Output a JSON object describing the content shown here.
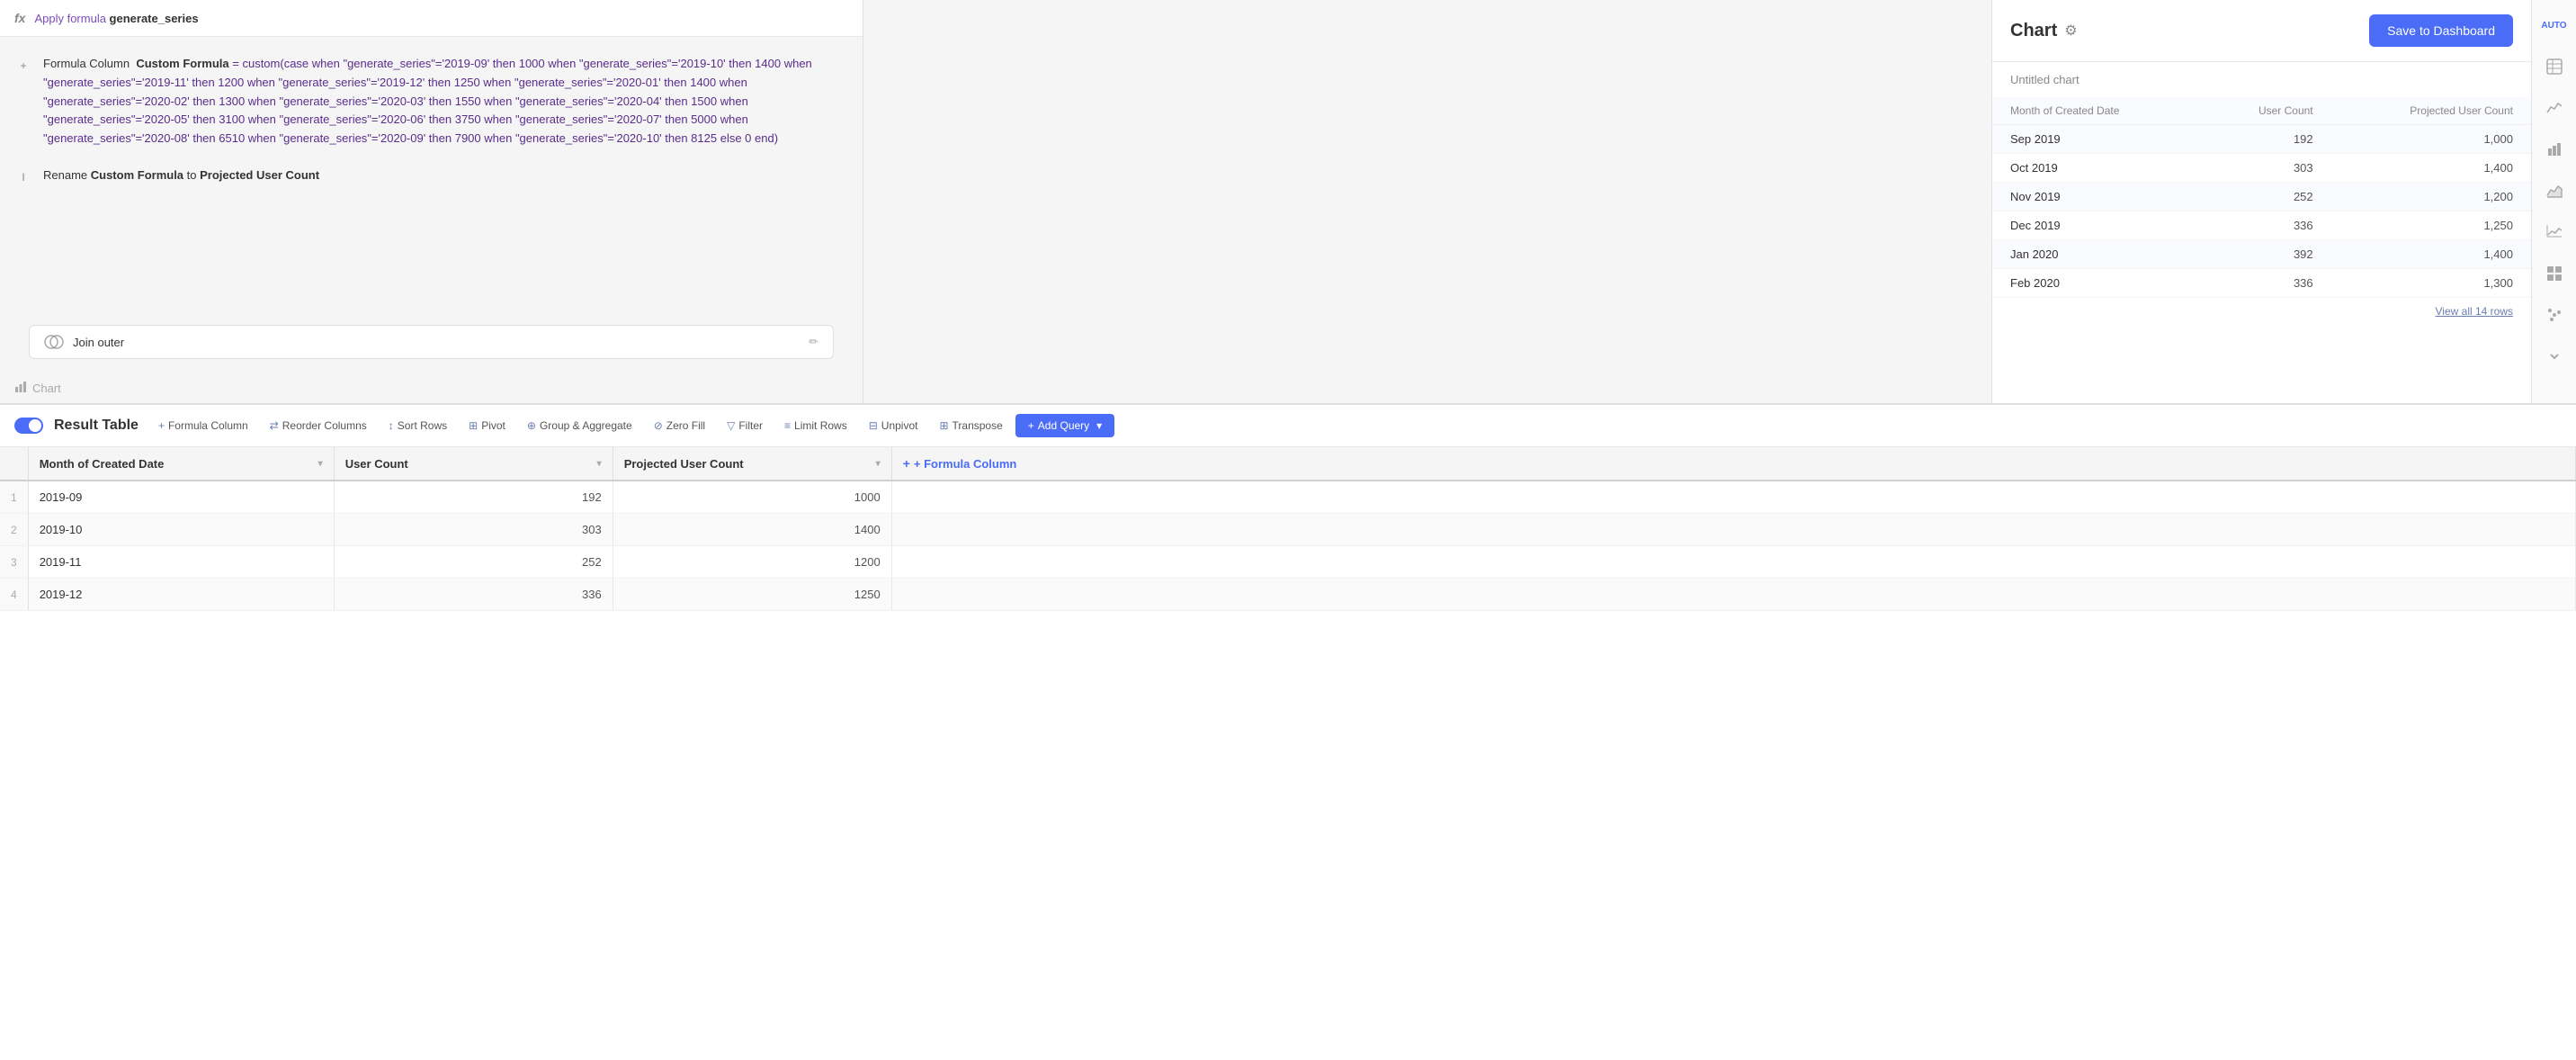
{
  "formula_bar": {
    "icon": "fx",
    "text_prefix": "Apply formula ",
    "text_bold": "generate_series"
  },
  "step1": {
    "label": "Formula Column",
    "keyword": "Custom Formula",
    "eq": " = ",
    "value": "custom(case when \"generate_series\"='2019-09' then 1000 when \"generate_series\"='2019-10' then 1400 when \"generate_series\"='2019-11' then 1200 when \"generate_series\"='2019-12' then 1250 when \"generate_series\"='2020-01' then 1400 when \"generate_series\"='2020-02' then 1300 when \"generate_series\"='2020-03' then 1550 when \"generate_series\"='2020-04' then 1500 when \"generate_series\"='2020-05' then 3100 when \"generate_series\"='2020-06' then 3750 when \"generate_series\"='2020-07' then 5000 when \"generate_series\"='2020-08' then 6510 when \"generate_series\"='2020-09' then 7900 when \"generate_series\"='2020-10' then 8125 else 0 end)"
  },
  "step2": {
    "prefix": "Rename ",
    "keyword": "Custom Formula",
    "middle": " to ",
    "value": "Projected User Count"
  },
  "join_bar": {
    "text": "Join outer",
    "edit_label": "edit"
  },
  "chart_tab": {
    "label": "Chart"
  },
  "chart": {
    "title": "Chart",
    "subtitle": "Untitled chart",
    "save_button": "Save to Dashboard",
    "columns": [
      "Month of Created Date",
      "User Count",
      "Projected User Count"
    ],
    "rows": [
      {
        "month": "Sep 2019",
        "user_count": "192",
        "projected": "1,000"
      },
      {
        "month": "Oct 2019",
        "user_count": "303",
        "projected": "1,400"
      },
      {
        "month": "Nov 2019",
        "user_count": "252",
        "projected": "1,200"
      },
      {
        "month": "Dec 2019",
        "user_count": "336",
        "projected": "1,250"
      },
      {
        "month": "Jan 2020",
        "user_count": "392",
        "projected": "1,400"
      },
      {
        "month": "Feb 2020",
        "user_count": "336",
        "projected": "1,300"
      }
    ],
    "view_all": "View all 14 rows"
  },
  "result_table": {
    "title": "Result Table",
    "toolbar": {
      "formula_column": "+ Formula Column",
      "reorder_columns": "⇄ Reorder Columns",
      "sort_rows": "↕ Sort Rows",
      "pivot": "⊞ Pivot",
      "group_aggregate": "⊕ Group & Aggregate",
      "zero_fill": "⊘ Zero Fill",
      "filter": "▽ Filter",
      "limit_rows": "≡ Limit Rows",
      "unpivot": "⊟ Unpivot",
      "transpose": "⊞ Transpose",
      "add_query": "+ Add Query"
    },
    "columns": [
      "Month of Created Date",
      "User Count",
      "Projected User Count",
      "+ Formula Column"
    ],
    "rows": [
      {
        "num": "1",
        "month": "2019-09",
        "user_count": "192",
        "projected": "1000"
      },
      {
        "num": "2",
        "month": "2019-10",
        "user_count": "303",
        "projected": "1400"
      },
      {
        "num": "3",
        "month": "2019-11",
        "user_count": "252",
        "projected": "1200"
      },
      {
        "num": "4",
        "month": "2019-12",
        "user_count": "336",
        "projected": "1250"
      }
    ]
  },
  "sidebar_icons": [
    "auto-label",
    "table-icon",
    "line-chart-icon",
    "bar-chart-icon",
    "area-chart-icon",
    "scatter-icon",
    "grid-icon",
    "dot-icon",
    "chevron-icon"
  ],
  "colors": {
    "primary": "#4a6cf7",
    "purple_text": "#7c4dba",
    "accent": "#5a2d8c"
  }
}
